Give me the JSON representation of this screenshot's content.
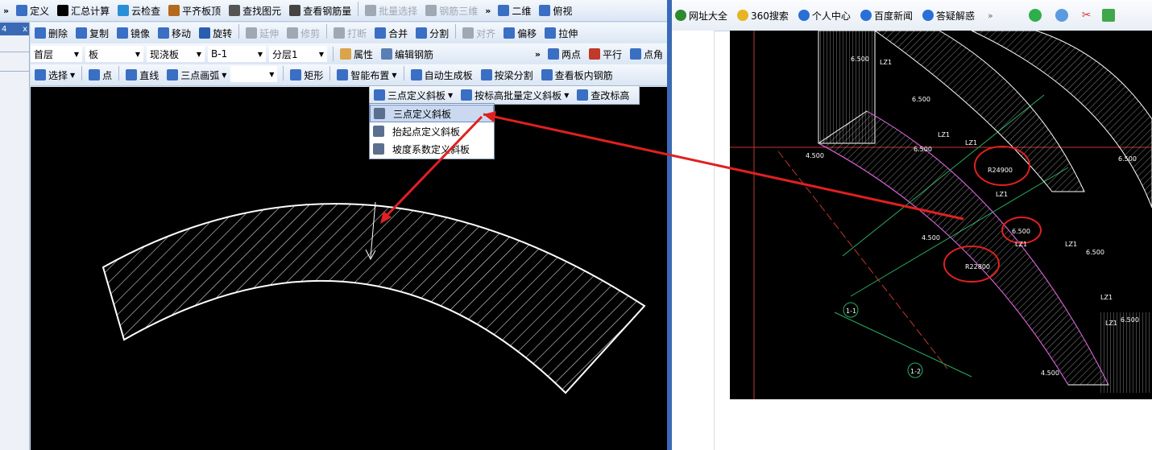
{
  "app": {
    "toolbar1": [
      {
        "label": "定义",
        "icon": "define-icon",
        "color": "#3a6fc4"
      },
      {
        "label": "汇总计算",
        "icon": "sigma-icon",
        "color": "#000000"
      },
      {
        "label": "云检查",
        "icon": "cloud-check-icon",
        "color": "#2a8fd6"
      },
      {
        "label": "平齐板顶",
        "icon": "align-slab-icon",
        "color": "#b46a1e"
      },
      {
        "label": "查找图元",
        "icon": "binoculars-icon",
        "color": "#555555"
      },
      {
        "label": "查看钢筋量",
        "icon": "rebar-view-icon",
        "color": "#444444"
      },
      {
        "label": "批量选择",
        "icon": "batch-select-icon",
        "color": "#a0a8b4",
        "disabled": true
      },
      {
        "label": "钢筋三维",
        "icon": "rebar-3d-icon",
        "color": "#a0a8b4",
        "disabled": true
      }
    ],
    "toolbar1_right": [
      {
        "label": "二维",
        "icon": "2d-view-icon",
        "color": "#3a6fc4"
      },
      {
        "label": "俯视",
        "icon": "top-view-icon",
        "color": "#3a6fc4"
      }
    ],
    "toolbar2": [
      {
        "label": "删除",
        "icon": "delete-icon",
        "color": "#3a6fc4"
      },
      {
        "label": "复制",
        "icon": "copy-icon",
        "color": "#3a6fc4"
      },
      {
        "label": "镜像",
        "icon": "mirror-icon",
        "color": "#3a6fc4"
      },
      {
        "label": "移动",
        "icon": "move-icon",
        "color": "#3a6fc4"
      },
      {
        "label": "旋转",
        "icon": "rotate-icon",
        "color": "#2a5fb0"
      },
      {
        "label": "延伸",
        "icon": "extend-icon",
        "color": "#a0a8b4",
        "disabled": true
      },
      {
        "label": "修剪",
        "icon": "trim-icon",
        "color": "#a0a8b4",
        "disabled": true
      },
      {
        "label": "打断",
        "icon": "break-icon",
        "color": "#a0a8b4",
        "disabled": true
      },
      {
        "label": "合并",
        "icon": "merge-icon",
        "color": "#3a6fc4"
      },
      {
        "label": "分割",
        "icon": "split-icon",
        "color": "#3a6fc4"
      },
      {
        "label": "对齐",
        "icon": "align-icon",
        "color": "#a0a8b4",
        "disabled": true
      },
      {
        "label": "偏移",
        "icon": "offset-icon",
        "color": "#3a6fc4"
      },
      {
        "label": "拉伸",
        "icon": "stretch-icon",
        "color": "#3a6fc4"
      }
    ],
    "toolbar3": {
      "floor": "首层",
      "component": "板",
      "type": "现浇板",
      "name": "B-1",
      "layer": "分层1",
      "props_label": "属性",
      "edit_rebar_label": "编辑钢筋",
      "right": [
        {
          "label": "两点",
          "icon": "two-point-icon",
          "color": "#3a6fc4"
        },
        {
          "label": "平行",
          "icon": "parallel-icon",
          "color": "#c0392b"
        },
        {
          "label": "点角",
          "icon": "point-angle-icon",
          "color": "#3a6fc4"
        }
      ]
    },
    "toolbar4": [
      {
        "label": "选择",
        "icon": "select-cursor-icon",
        "color": "#3a6fc4",
        "dropdown": true
      },
      {
        "label": "点",
        "icon": "point-icon",
        "color": "#3a6fc4"
      },
      {
        "label": "直线",
        "icon": "line-icon",
        "color": "#3a6fc4"
      },
      {
        "label": "三点画弧",
        "icon": "arc-icon",
        "color": "#3a6fc4",
        "dropdown": true
      },
      {
        "label": "矩形",
        "icon": "rectangle-icon",
        "color": "#3a6fc4"
      },
      {
        "label": "智能布置",
        "icon": "smart-layout-icon",
        "color": "#3a6fc4",
        "dropdown": true
      },
      {
        "label": "自动生成板",
        "icon": "auto-slab-icon",
        "color": "#3a6fc4"
      },
      {
        "label": "按梁分割",
        "icon": "beam-split-icon",
        "color": "#3a6fc4"
      },
      {
        "label": "查看板内钢筋",
        "icon": "slab-rebar-icon",
        "color": "#3a6fc4"
      }
    ],
    "sub_toolbar": [
      {
        "label": "三点定义斜板",
        "icon": "three-point-slope-icon",
        "dropdown": true
      },
      {
        "label": "按标高批量定义斜板",
        "icon": "batch-slope-icon",
        "dropdown": true
      },
      {
        "label": "查改标高",
        "icon": "elevation-icon"
      }
    ],
    "dropdown_menu": [
      {
        "label": "三点定义斜板",
        "icon": "three-point-slope-icon",
        "selected": true
      },
      {
        "label": "抬起点定义斜板",
        "icon": "raise-point-slope-icon"
      },
      {
        "label": "坡度系数定义斜板",
        "icon": "slope-coeff-icon"
      }
    ],
    "left_panel_labels": [
      "4",
      "x"
    ]
  },
  "browser": {
    "bookmarks": [
      {
        "label": "网址大全",
        "icon": "plus-icon",
        "color": "#2d8a2d"
      },
      {
        "label": "360搜索",
        "icon": "360-search-icon",
        "color": "#e8b51e"
      },
      {
        "label": "个人中心",
        "icon": "paw-icon",
        "color": "#2a6fd6"
      },
      {
        "label": "百度新闻",
        "icon": "baidu-paw-icon",
        "color": "#2a6fd6"
      },
      {
        "label": "答疑解惑",
        "icon": "lightbulb-icon",
        "color": "#2a6fd6"
      }
    ],
    "more_label": "»",
    "cad_labels": [
      "6.500",
      "6.500",
      "6.500",
      "6.500",
      "6.500",
      "6.500",
      "6.500",
      "4.500",
      "4.500",
      "4.500",
      "LZ1",
      "LZ1",
      "LZ1",
      "LZ1",
      "LZ1",
      "LZ1",
      "LZ1",
      "LZ1",
      "1-1",
      "1-2",
      "R24900",
      "R22800"
    ]
  }
}
